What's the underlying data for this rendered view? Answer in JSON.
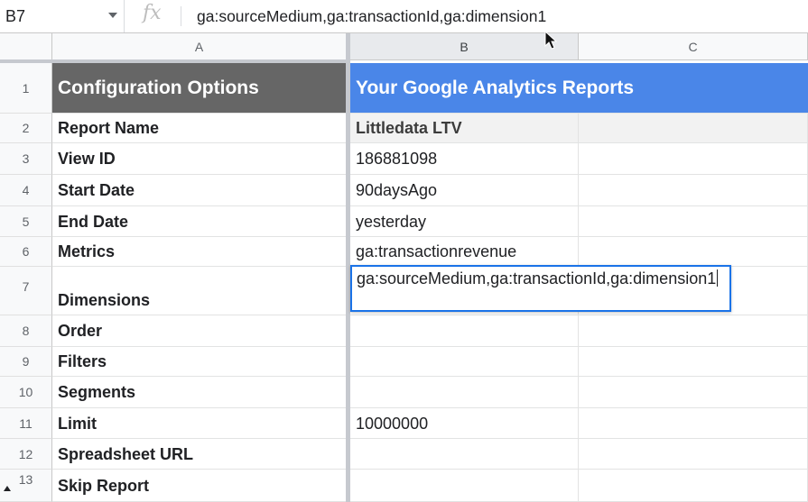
{
  "formula_bar": {
    "name_box": "B7",
    "fx_label": "fx",
    "formula": "ga:sourceMedium,ga:transactionId,ga:dimension1"
  },
  "columns": [
    "A",
    "B",
    "C"
  ],
  "rows": [
    {
      "num": "1",
      "a": "Configuration Options",
      "b": "Your Google Analytics Reports"
    },
    {
      "num": "2",
      "a": "Report Name",
      "b": "Littledata LTV"
    },
    {
      "num": "3",
      "a": "View ID",
      "b": "186881098"
    },
    {
      "num": "4",
      "a": "Start Date",
      "b": "90daysAgo"
    },
    {
      "num": "5",
      "a": "End Date",
      "b": "yesterday"
    },
    {
      "num": "6",
      "a": "Metrics",
      "b": "ga:transactionrevenue"
    },
    {
      "num": "7",
      "a": "Dimensions",
      "b": "ga:sourceMedium,ga:transactionId,ga:dimension1"
    },
    {
      "num": "8",
      "a": "Order",
      "b": ""
    },
    {
      "num": "9",
      "a": "Filters",
      "b": ""
    },
    {
      "num": "10",
      "a": "Segments",
      "b": ""
    },
    {
      "num": "11",
      "a": "Limit",
      "b": "10000000"
    },
    {
      "num": "12",
      "a": "Spreadsheet URL",
      "b": ""
    },
    {
      "num": "13",
      "a": "Skip Report",
      "b": ""
    }
  ],
  "colors": {
    "header_a": "#666666",
    "header_b": "#4a86e8",
    "selection": "#1a73e8"
  }
}
